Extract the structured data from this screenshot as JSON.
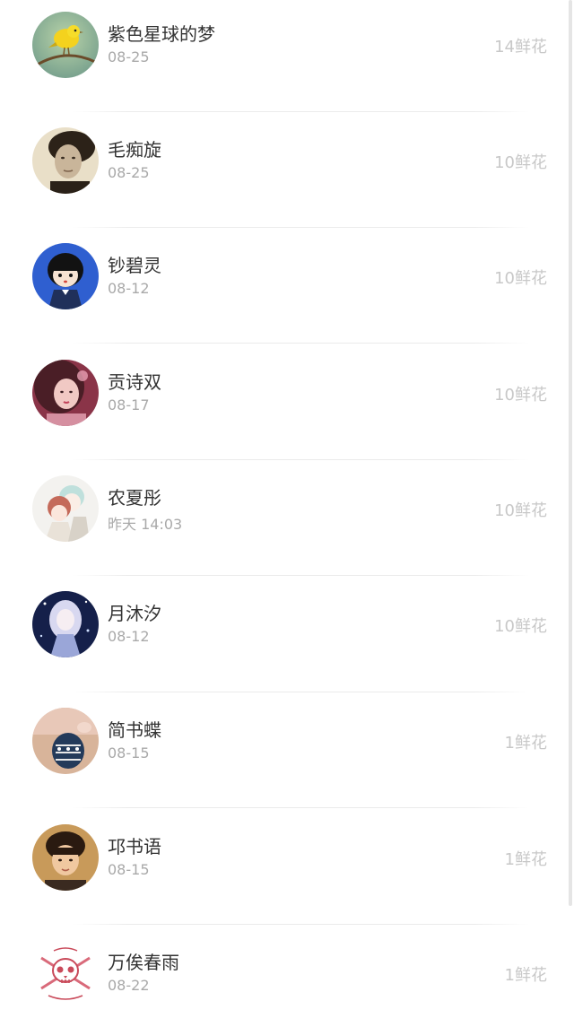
{
  "flower_unit": "鲜花",
  "gifts": [
    {
      "name": "紫色星球的梦",
      "date": "08-25",
      "flowers": "14鲜花",
      "avatar": "yellow-bird-avatar"
    },
    {
      "name": "毛痴旋",
      "date": "08-25",
      "flowers": "10鲜花",
      "avatar": "sepia-portrait-avatar"
    },
    {
      "name": "钞碧灵",
      "date": "08-12",
      "flowers": "10鲜花",
      "avatar": "cartoon-girl-avatar"
    },
    {
      "name": "贡诗双",
      "date": "08-17",
      "flowers": "10鲜花",
      "avatar": "pink-portrait-avatar"
    },
    {
      "name": "农夏彤",
      "date": "昨天 14:03",
      "flowers": "10鲜花",
      "avatar": "anime-couple-avatar"
    },
    {
      "name": "月沐汐",
      "date": "08-12",
      "flowers": "10鲜花",
      "avatar": "anime-night-avatar"
    },
    {
      "name": "简书蝶",
      "date": "08-15",
      "flowers": "1鲜花",
      "avatar": "knit-glove-avatar"
    },
    {
      "name": "邛书语",
      "date": "08-15",
      "flowers": "1鲜花",
      "avatar": "boy-photo-avatar"
    },
    {
      "name": "万俟春雨",
      "date": "08-22",
      "flowers": "1鲜花",
      "avatar": "skull-logo-avatar"
    }
  ]
}
